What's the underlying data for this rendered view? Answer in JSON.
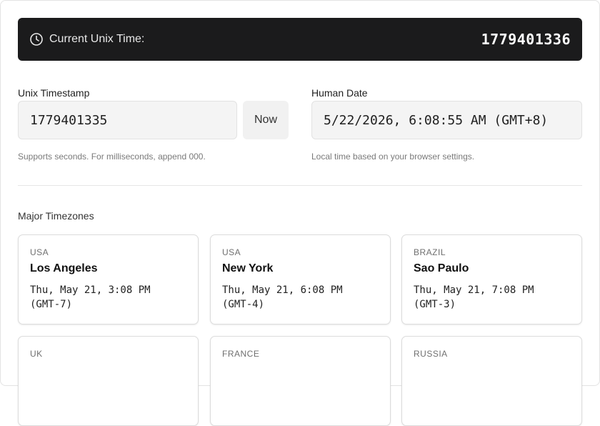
{
  "header": {
    "label": "Current Unix Time:",
    "value": "1779401336",
    "icon": "clock-icon"
  },
  "unix_field": {
    "label": "Unix Timestamp",
    "value": "1779401335",
    "now_label": "Now",
    "hint": "Supports seconds. For milliseconds, append 000."
  },
  "human_field": {
    "label": "Human Date",
    "value": "5/22/2026, 6:08:55 AM (GMT+8)",
    "hint": "Local time based on your browser settings."
  },
  "timezones": {
    "title": "Major Timezones",
    "cards": [
      {
        "country": "USA",
        "city": "Los Angeles",
        "time": "Thu, May 21, 3:08 PM (GMT-7)"
      },
      {
        "country": "USA",
        "city": "New York",
        "time": "Thu, May 21, 6:08 PM (GMT-4)"
      },
      {
        "country": "BRAZIL",
        "city": "Sao Paulo",
        "time": "Thu, May 21, 7:08 PM (GMT-3)"
      },
      {
        "country": "UK",
        "city": "",
        "time": ""
      },
      {
        "country": "FRANCE",
        "city": "",
        "time": ""
      },
      {
        "country": "RUSSIA",
        "city": "",
        "time": ""
      }
    ]
  },
  "colors": {
    "header_bg": "#1b1b1c",
    "input_bg": "#f4f4f4",
    "hint_text": "#7a7a7a"
  }
}
